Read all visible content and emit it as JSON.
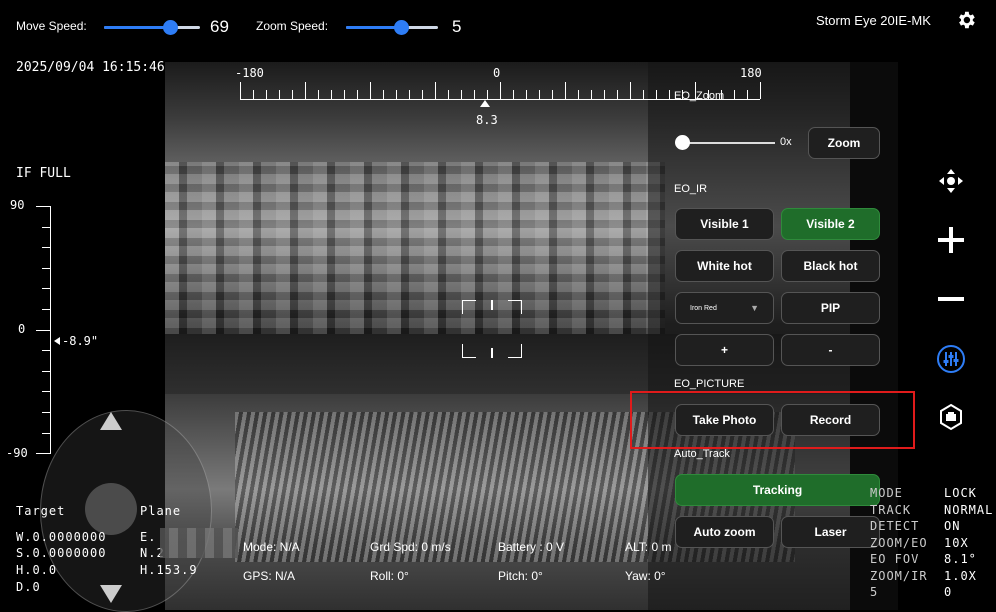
{
  "top": {
    "move_speed_label": "Move Speed:",
    "move_speed_value": "69",
    "move_speed_fraction": 0.69,
    "zoom_speed_label": "Zoom Speed:",
    "zoom_speed_value": "5",
    "zoom_speed_fraction": 0.6,
    "device_name": "Storm Eye 20IE-MK"
  },
  "overlay": {
    "datetime": "2025/09/04  16:15:46",
    "heading_left": "-180",
    "heading_center": "0",
    "heading_right": "180",
    "heading_value": "8.3",
    "ir_mode": "IF FULL",
    "scale_top": "90",
    "scale_mid": "0",
    "scale_bottom": "-90",
    "pitch_value": "-8.9\""
  },
  "panel": {
    "eo_zoom_label": "EO_Zoom",
    "zoom_value": "0x",
    "zoom_fraction": 0.0,
    "zoom_button": "Zoom",
    "eo_ir_label": "EO_IR",
    "visible1": "Visible 1",
    "visible2": "Visible 2",
    "white_hot": "White hot",
    "black_hot": "Black hot",
    "palette_select": "Iron Red",
    "pip": "PIP",
    "plus": "+",
    "minus": "-",
    "eo_picture_label": "EO_PICTURE",
    "take_photo": "Take Photo",
    "record": "Record",
    "auto_track_label": "Auto_Track",
    "tracking": "Tracking",
    "auto_zoom": "Auto zoom",
    "laser": "Laser"
  },
  "target": {
    "title": "Target",
    "w": "W.0.0000000",
    "s": "S.0.0000000",
    "h": "H.0.0",
    "d": "D.0"
  },
  "plane": {
    "title": "Plane",
    "e": "E.",
    "n": "N.2",
    "h": "H.153.9"
  },
  "telemetry": {
    "mode": "Mode: N/A",
    "grd_spd": "Grd Spd: 0 m/s",
    "battery": "Battery : 0 V",
    "alt": "ALT: 0 m",
    "gps": "GPS: N/A",
    "roll": "Roll: 0°",
    "pitch": "Pitch: 0°",
    "yaw": "Yaw: 0°"
  },
  "status": {
    "rows": [
      {
        "k": "MODE",
        "v": "LOCK"
      },
      {
        "k": "TRACK",
        "v": "NORMAL"
      },
      {
        "k": "DETECT",
        "v": "ON"
      },
      {
        "k": "ZOOM/EO",
        "v": "10X"
      },
      {
        "k": "EO FOV",
        "v": "8.1°"
      },
      {
        "k": "ZOOM/IR",
        "v": "1.0X"
      },
      {
        "k": "5",
        "v": "0"
      }
    ]
  },
  "colors": {
    "accent_blue": "#2e7df6",
    "green_button": "#1f6d2a",
    "highlight_red": "#e01b1b"
  },
  "icons": [
    "gear-icon",
    "move-icon",
    "plus-icon",
    "minus-icon",
    "sliders-icon",
    "camera-badge-icon"
  ]
}
